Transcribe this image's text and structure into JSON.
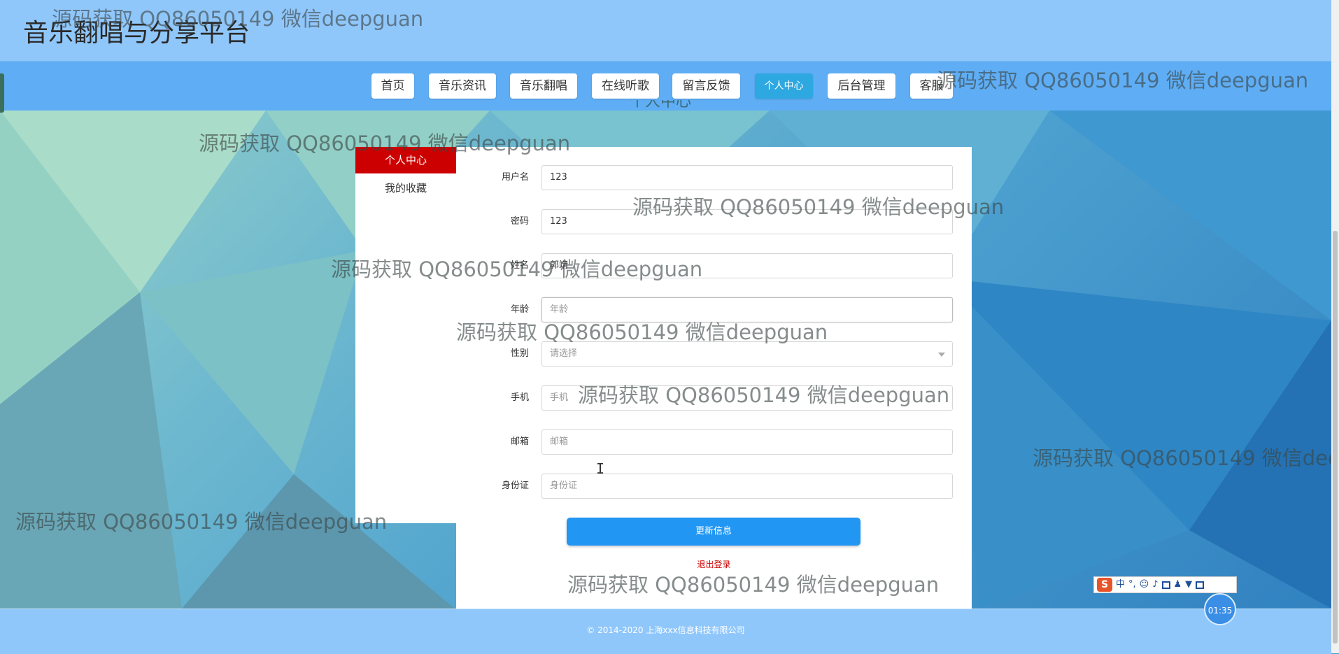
{
  "site": {
    "title": "音乐翻唱与分享平台"
  },
  "nav": {
    "items": [
      {
        "label": "首页"
      },
      {
        "label": "音乐资讯"
      },
      {
        "label": "音乐翻唱"
      },
      {
        "label": "在线听歌"
      },
      {
        "label": "留言反馈"
      },
      {
        "label": "个人中心",
        "active": true
      },
      {
        "label": "后台管理"
      },
      {
        "label": "客服"
      }
    ]
  },
  "page": {
    "heading": "个人中心"
  },
  "sidebar": {
    "items": [
      {
        "label": "个人中心",
        "active": true
      },
      {
        "label": "我的收藏"
      }
    ]
  },
  "form": {
    "fields": [
      {
        "label": "用户名",
        "value": "123",
        "placeholder": "用户名"
      },
      {
        "label": "密码",
        "value": "123",
        "placeholder": "密码"
      },
      {
        "label": "姓名",
        "value": "郭靖",
        "placeholder": "姓名"
      },
      {
        "label": "年龄",
        "value": "",
        "placeholder": "年龄"
      },
      {
        "label": "性别",
        "value": "",
        "placeholder": "请选择"
      },
      {
        "label": "手机",
        "value": "",
        "placeholder": "手机"
      },
      {
        "label": "邮箱",
        "value": "",
        "placeholder": "邮箱"
      },
      {
        "label": "身份证",
        "value": "",
        "placeholder": "身份证"
      }
    ],
    "submit_label": "更新信息",
    "logout_label": "退出登录"
  },
  "footer": {
    "text": "© 2014-2020 上海xxx信息科技有限公司"
  },
  "watermark": {
    "text": "源码获取 QQ86050149 微信deepguan"
  },
  "ime": {
    "logo": "S",
    "mode": "中",
    "punct": "°,"
  },
  "timer": {
    "value": "01:35"
  },
  "colors": {
    "topbar": "#90c7fb",
    "navbar": "#5faef5",
    "sidebar_active": "#cc0000",
    "primary_button": "#2196f3",
    "nav_active": "#2ea8e0",
    "logout": "#cc0000"
  }
}
